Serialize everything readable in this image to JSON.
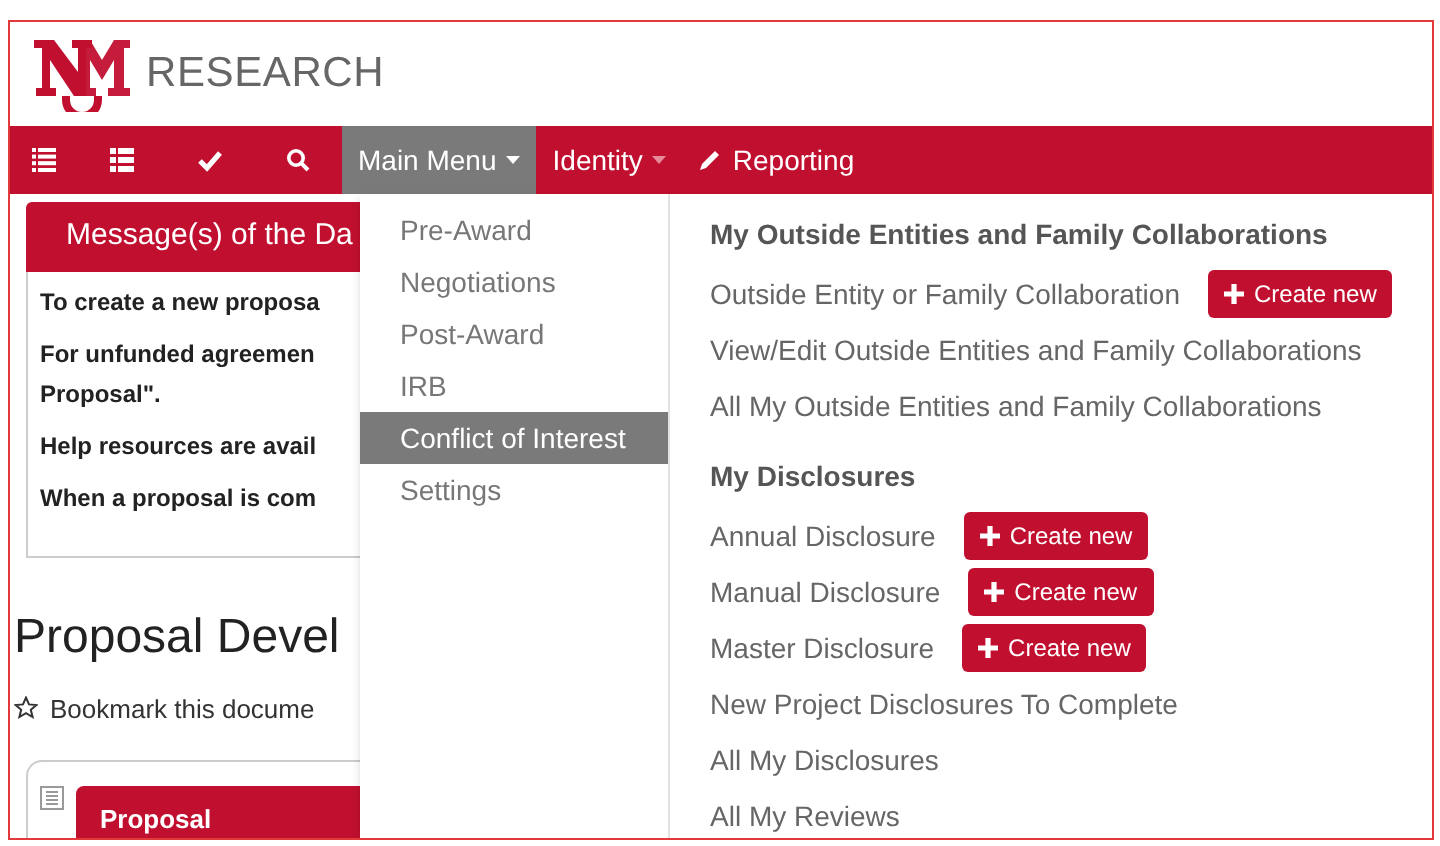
{
  "header": {
    "logo_text": "RESEARCH"
  },
  "navbar": {
    "menus": [
      {
        "label": "Main Menu",
        "kind": "dropdown",
        "selected": true
      },
      {
        "label": "Identity",
        "kind": "dropdown",
        "selected": false
      },
      {
        "label": "Reporting",
        "kind": "link",
        "selected": false
      }
    ]
  },
  "message_card": {
    "title": "Message(s) of the Da",
    "lines": [
      "To create a new proposa",
      "For unfunded agreemen",
      "Proposal\".",
      "Help resources are avail",
      "When a proposal is com"
    ]
  },
  "page_title": "Proposal Devel",
  "bookmark": "Bookmark this docume",
  "proposal_tab": "Proposal",
  "main_menu": {
    "items": [
      {
        "label": "Pre-Award",
        "selected": false
      },
      {
        "label": "Negotiations",
        "selected": false
      },
      {
        "label": "Post-Award",
        "selected": false
      },
      {
        "label": "IRB",
        "selected": false
      },
      {
        "label": "Conflict of Interest",
        "selected": true
      },
      {
        "label": "Settings",
        "selected": false
      }
    ],
    "sections": [
      {
        "heading": "My Outside Entities and Family Collaborations",
        "items": [
          {
            "label": "Outside Entity or Family Collaboration",
            "button": "Create new"
          },
          {
            "label": "View/Edit Outside Entities and Family Collaborations"
          },
          {
            "label": "All My Outside Entities and Family Collaborations"
          }
        ]
      },
      {
        "heading": "My Disclosures",
        "items": [
          {
            "label": "Annual Disclosure",
            "button": "Create new"
          },
          {
            "label": "Manual Disclosure",
            "button": "Create new"
          },
          {
            "label": "Master Disclosure",
            "button": "Create new"
          },
          {
            "label": "New Project Disclosures To Complete"
          },
          {
            "label": "All My Disclosures"
          },
          {
            "label": "All My Reviews"
          }
        ]
      }
    ]
  }
}
